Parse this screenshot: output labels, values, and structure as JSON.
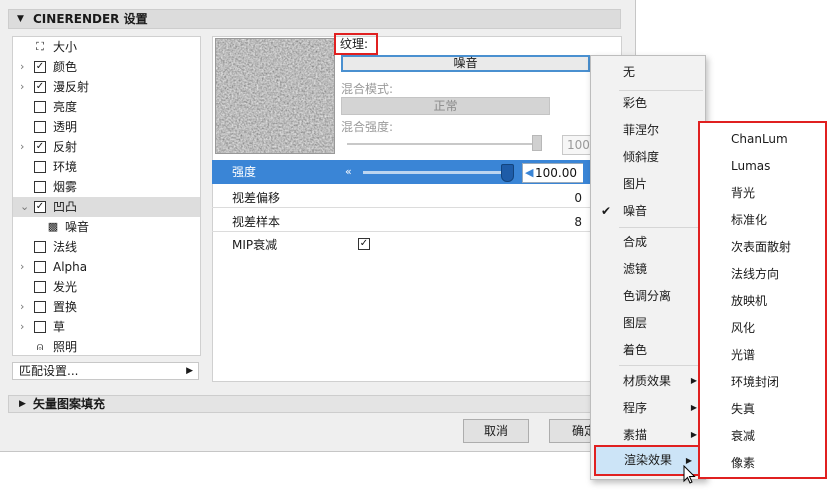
{
  "dialog": {
    "section_title": "CINERENDER 设置",
    "vector_section": "矢量图案填充",
    "match_settings": "匹配设置...",
    "cancel_label": "取消",
    "ok_label": "确定"
  },
  "tree": [
    {
      "label": "大小",
      "arrow": "",
      "check": "none",
      "icon": "size"
    },
    {
      "label": "颜色",
      "arrow": "›",
      "check": "checked"
    },
    {
      "label": "漫反射",
      "arrow": "›",
      "check": "checked"
    },
    {
      "label": "亮度",
      "arrow": "",
      "check": "unchecked"
    },
    {
      "label": "透明",
      "arrow": "",
      "check": "unchecked"
    },
    {
      "label": "反射",
      "arrow": "›",
      "check": "checked"
    },
    {
      "label": "环境",
      "arrow": "",
      "check": "unchecked"
    },
    {
      "label": "烟雾",
      "arrow": "",
      "check": "unchecked"
    },
    {
      "label": "凹凸",
      "arrow": "⌄",
      "check": "checked",
      "selected": true
    },
    {
      "label": "噪音",
      "arrow": "",
      "check": "none",
      "icon": "noise",
      "child": true
    },
    {
      "label": "法线",
      "arrow": "",
      "check": "unchecked"
    },
    {
      "label": "Alpha",
      "arrow": "›",
      "check": "unchecked"
    },
    {
      "label": "发光",
      "arrow": "",
      "check": "unchecked"
    },
    {
      "label": "置换",
      "arrow": "›",
      "check": "unchecked"
    },
    {
      "label": "草",
      "arrow": "›",
      "check": "unchecked"
    },
    {
      "label": "照明",
      "arrow": "",
      "check": "none",
      "icon": "light"
    }
  ],
  "panel": {
    "texture_label": "纹理:",
    "texture_value": "噪音",
    "blend_mode_label": "混合模式:",
    "blend_mode_value": "正常",
    "blend_strength_label": "混合强度:",
    "blend_strength_value": "100.0",
    "strength_label": "强度",
    "strength_value": "100.00",
    "strength_fraction": 0.98,
    "parallax_offset_label": "视差偏移",
    "parallax_offset_value": "0",
    "parallax_samples_label": "视差样本",
    "parallax_samples_value": "8",
    "mip_label": "MIP衰减",
    "mip_checked": true
  },
  "menu": {
    "items": [
      "无",
      "彩色",
      "菲涅尔",
      "倾斜度",
      "图片",
      "噪音",
      "合成",
      "滤镜",
      "色调分离",
      "图层",
      "着色",
      "材质效果",
      "程序",
      "素描",
      "渲染效果"
    ],
    "checked_item": "噪音"
  },
  "submenu": {
    "items": [
      "ChanLum",
      "Lumas",
      "背光",
      "标准化",
      "次表面散射",
      "法线方向",
      "放映机",
      "风化",
      "光谱",
      "环境封闭",
      "失真",
      "衰减",
      "像素"
    ]
  },
  "colors": {
    "accent": "#3a85d6",
    "highlight_border": "#e02020",
    "menu_hover": "#cce4f7"
  }
}
